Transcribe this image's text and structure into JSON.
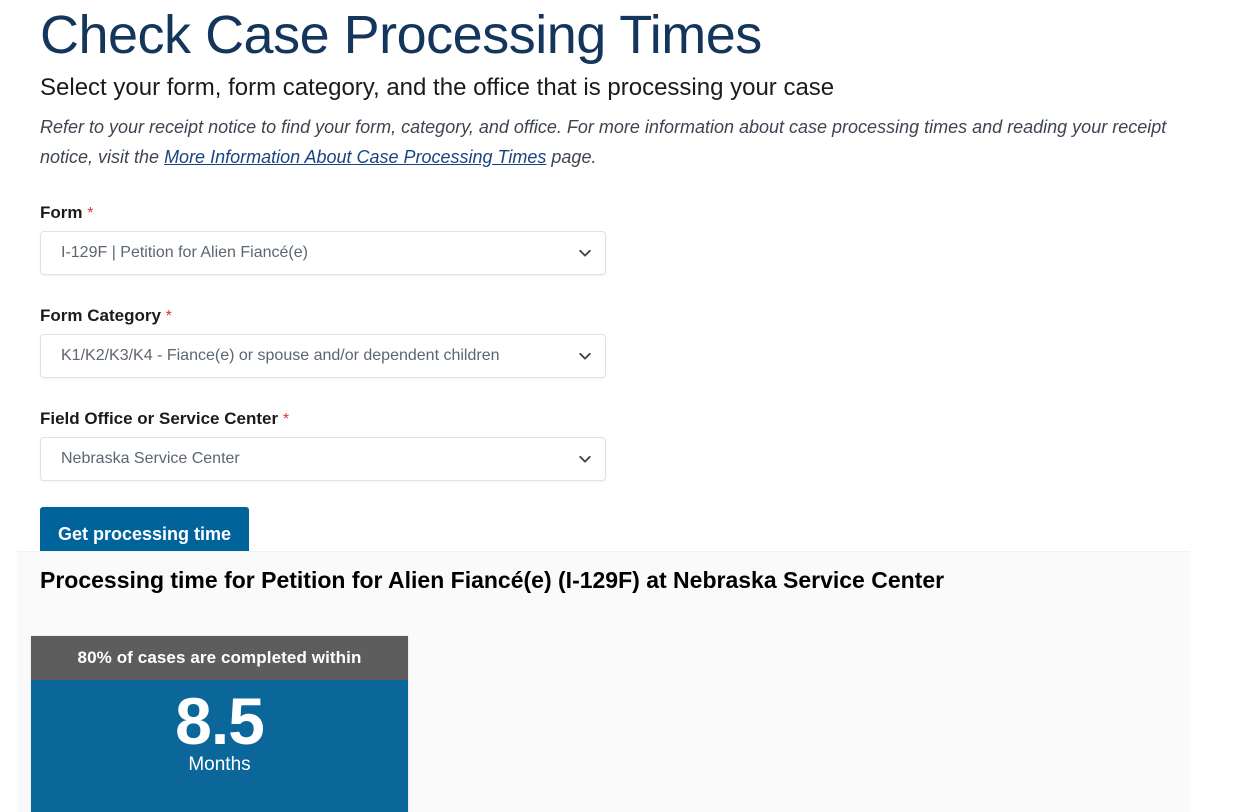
{
  "header": {
    "title": "Check Case Processing Times",
    "subtitle": "Select your form, form category, and the office that is processing your case",
    "intro_before": "Refer to your receipt notice to find your form, category, and office. For more information about case processing times and reading your receipt notice, visit the ",
    "intro_link": "More Information About Case Processing Times",
    "intro_after": " page."
  },
  "form": {
    "required_marker": "*",
    "fields": [
      {
        "label": "Form",
        "required": true,
        "value": "I-129F | Petition for Alien Fiancé(e)",
        "icon": "chevron-down-icon"
      },
      {
        "label": "Form Category",
        "required": true,
        "value": "K1/K2/K3/K4 - Fiance(e) or spouse and/or dependent children",
        "icon": "chevron-down-icon"
      },
      {
        "label": "Field Office or Service Center",
        "required": true,
        "value": "Nebraska Service Center",
        "icon": "chevron-down-icon"
      }
    ],
    "submit_label": "Get processing time"
  },
  "results": {
    "title": "Processing time for Petition for Alien Fiancé(e) (I-129F) at Nebraska Service Center",
    "card": {
      "header_label": "80% of cases are completed within",
      "value": "8.5",
      "unit": "Months",
      "header_color": "#5d5d5d",
      "body_color": "#0b6699"
    }
  },
  "colors": {
    "title_blue": "#15365c",
    "link_blue": "#1a4480",
    "button_blue": "#00639a",
    "required_red": "#d83933",
    "panel_gray": "#fafafa"
  }
}
